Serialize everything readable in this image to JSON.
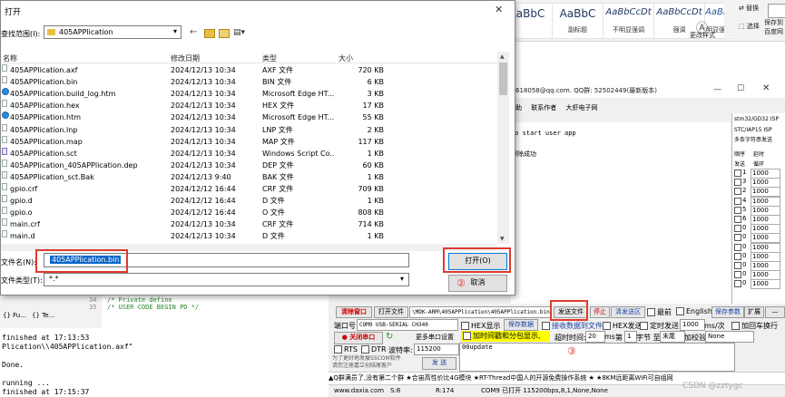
{
  "ribbon": {
    "styles": [
      {
        "sample": "AaBbC",
        "name": ""
      },
      {
        "sample": "AaBbC",
        "name": "副标题"
      },
      {
        "sample": "AaBbCcDt",
        "name": "不明显强调"
      },
      {
        "sample": "AaBbCcDt",
        "name": "强调"
      },
      {
        "sample": "AaBbCcD",
        "name": "明显强调"
      }
    ],
    "cmd_replace": "替换",
    "cmd_select": "选择",
    "cmd_change_style": "更改样式",
    "cmd_save_to": "保存到",
    "cmd_baidu": "百度网"
  },
  "serial": {
    "title": "618058@qq.com. QQ群: 52502449(最新版本)",
    "menu": [
      "助",
      "联系作者",
      "大虾电子网"
    ],
    "log_lines": [
      "to start user app",
      "擦除成功"
    ],
    "right_header": [
      "stm32/GD32 ISP",
      "STC/IAP15 ISP",
      "多条字符串发送"
    ],
    "right_cols": [
      "顺序",
      "延时"
    ],
    "right_sub": [
      "发送",
      "循环"
    ],
    "right_rows": [
      {
        "n": "1",
        "v": "1000"
      },
      {
        "n": "3",
        "v": "1000"
      },
      {
        "n": "2",
        "v": "1000"
      },
      {
        "n": "4",
        "v": "1000"
      },
      {
        "n": "5",
        "v": "1000"
      },
      {
        "n": "6",
        "v": "1000"
      },
      {
        "n": "0",
        "v": "1000"
      },
      {
        "n": "0",
        "v": "1000"
      },
      {
        "n": "0",
        "v": "1000"
      },
      {
        "n": "0",
        "v": "1000"
      },
      {
        "n": "0",
        "v": "1000"
      },
      {
        "n": "0",
        "v": "1000"
      },
      {
        "n": "0",
        "v": "1000"
      }
    ],
    "btn_clear": "清除窗口",
    "btn_open_file": "打开文件",
    "file_path": "\\MDK-ARM\\405APPlication\\405APPlication.bin",
    "btn_send_file": "发送文件",
    "btn_stop": "停止",
    "btn_clear_send": "清发送区",
    "chk_top": "最前",
    "chk_english": "English",
    "btn_save_params": "保存参数",
    "btn_expand": "扩展",
    "btn_dash": "—",
    "port_label": "端口号",
    "port_value": "COM9 USB-SERIAL CH340",
    "chk_hex_display": "HEX显示",
    "btn_save_data": "保存数据",
    "chk_recv_to_file": "接收数据到文件",
    "chk_hex_send": "HEX发送",
    "chk_timed_send": "定时发送",
    "interval_value": "1000",
    "interval_unit": "ms/次",
    "chk_add_crlf": "加回车换行",
    "btn_close_port": "关闭串口",
    "btn_more_settings": "更多串口设置",
    "chk_timestamp": "加时间戳和分包显示,",
    "timeout_label": "超时时间:",
    "timeout_value": "20",
    "timeout_unit": "ms",
    "byte_no": "第",
    "byte_value": "1",
    "byte_unit": "字节 至",
    "byte_end": "末尾",
    "verify_label": "加校验",
    "verify_value": "None",
    "chk_rts": "RTS",
    "chk_dtr": "DTR",
    "baud_label": "波特率:",
    "baud_value": "115200",
    "send_text": "00update",
    "btn_send": "发 送",
    "promo": "为了更好地发展SSCOM软件\n请您注册嘉立创结尾客户",
    "ticker": "▲Q群满员了,没有第二个群  ★合宙高性价比4G模块 ★RT-Thread中国人的开源免费操作系统 ★ ★8KM远距离WiFi可自组网",
    "status": {
      "site": "www.daxia.com",
      "s": "S:8",
      "r": "R:174",
      "port": "COM9 已打开  115200bps,8,1,None,None"
    },
    "anno3": "③"
  },
  "ide": {
    "tabs": [
      "{} Fu...",
      "{} Te..."
    ],
    "code_lines": [
      {
        "num": "34",
        "text": "/* Private define"
      },
      {
        "num": "35",
        "text": "/* USER CODE BEGIN PD */"
      }
    ],
    "output": [
      "finished at 17:13:53",
      "Plication\\\\405APPlication.axf\"",
      "",
      " Done.",
      "",
      " running ...",
      "finished at 17:15:37"
    ]
  },
  "dialog": {
    "title": "打开",
    "lookin_label": "查找范围(I):",
    "lookin_value": "405APPlication",
    "columns": [
      "名称",
      "修改日期",
      "类型",
      "大小"
    ],
    "files": [
      {
        "name": "405APPlication.axf",
        "date": "2024/12/13 10:34",
        "type": "AXF 文件",
        "size": "720 KB",
        "icon": "file-icon"
      },
      {
        "name": "405APPlication.bin",
        "date": "2024/12/13 10:34",
        "type": "BIN 文件",
        "size": "6 KB",
        "icon": "file-icon"
      },
      {
        "name": "405APPlication.build_log.htm",
        "date": "2024/12/13 10:34",
        "type": "Microsoft Edge HT...",
        "size": "3 KB",
        "icon": "edge-icon"
      },
      {
        "name": "405APPlication.hex",
        "date": "2024/12/13 10:34",
        "type": "HEX 文件",
        "size": "17 KB",
        "icon": "file-icon"
      },
      {
        "name": "405APPlication.htm",
        "date": "2024/12/13 10:34",
        "type": "Microsoft Edge HT...",
        "size": "55 KB",
        "icon": "edge-icon"
      },
      {
        "name": "405APPlication.lnp",
        "date": "2024/12/13 10:34",
        "type": "LNP 文件",
        "size": "2 KB",
        "icon": "file-icon"
      },
      {
        "name": "405APPlication.map",
        "date": "2024/12/13 10:34",
        "type": "MAP 文件",
        "size": "117 KB",
        "icon": "file-icon"
      },
      {
        "name": "405APPlication.sct",
        "date": "2024/12/13 10:34",
        "type": "Windows Script Co...",
        "size": "1 KB",
        "icon": "script-icon"
      },
      {
        "name": "405APPlication_405APPlication.dep",
        "date": "2024/12/13 10:34",
        "type": "DEP 文件",
        "size": "60 KB",
        "icon": "file-icon"
      },
      {
        "name": "405APPlication_sct.Bak",
        "date": "2024/12/13 9:40",
        "type": "BAK 文件",
        "size": "1 KB",
        "icon": "bak-icon"
      },
      {
        "name": "gpio.crf",
        "date": "2024/12/12 16:44",
        "type": "CRF 文件",
        "size": "709 KB",
        "icon": "file-icon"
      },
      {
        "name": "gpio.d",
        "date": "2024/12/12 16:44",
        "type": "D 文件",
        "size": "1 KB",
        "icon": "file-icon"
      },
      {
        "name": "gpio.o",
        "date": "2024/12/12 16:44",
        "type": "O 文件",
        "size": "808 KB",
        "icon": "file-icon"
      },
      {
        "name": "main.crf",
        "date": "2024/12/13 10:34",
        "type": "CRF 文件",
        "size": "714 KB",
        "icon": "file-icon"
      },
      {
        "name": "main.d",
        "date": "2024/12/13 10:34",
        "type": "D 文件",
        "size": "1 KB",
        "icon": "file-icon"
      }
    ],
    "filename_label": "文件名(N):",
    "filename_value": "405APPlication.bin",
    "filetype_label": "文件类型(T):",
    "filetype_value": "*.*",
    "btn_open": "打开(O)",
    "btn_cancel": "取消",
    "anno1": "①",
    "anno2": "②"
  },
  "watermark": "CSDN @zztygc",
  "colors": {
    "annotation": "#e03a2e",
    "selection": "#0a64c8"
  }
}
